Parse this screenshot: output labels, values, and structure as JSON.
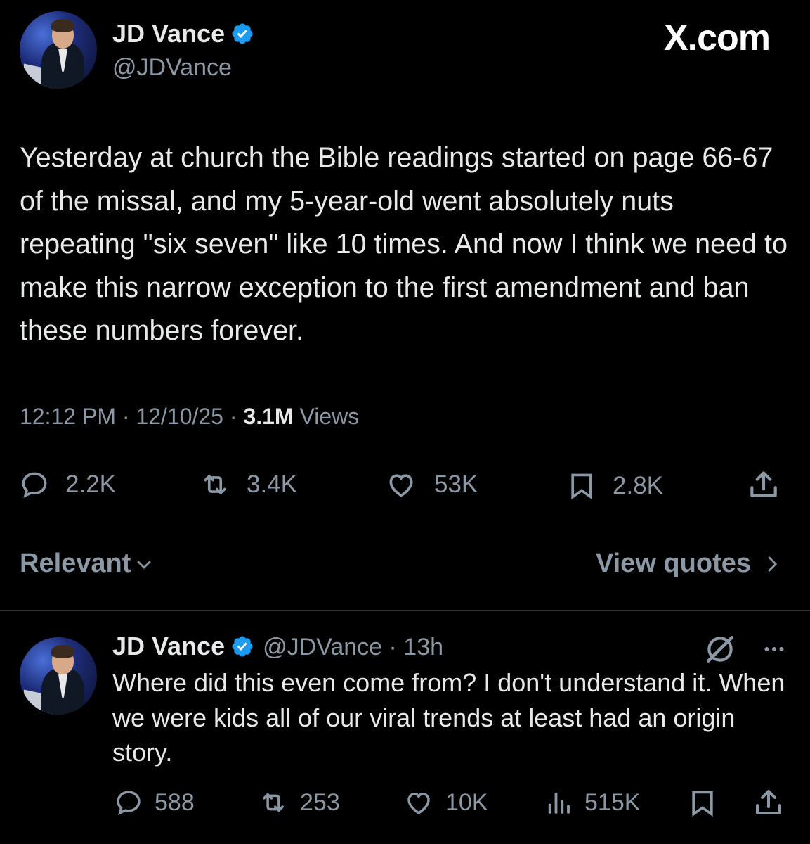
{
  "watermark": "X.com",
  "main_post": {
    "author_name": "JD Vance",
    "handle": "@JDVance",
    "text": "Yesterday at church the Bible readings started on page 66-67 of the missal, and my 5-year-old went absolutely nuts repeating \"six seven\" like 10 times. And now I think we need to make this narrow exception to the first amendment and ban these numbers forever.",
    "time": "12:12 PM",
    "date": "12/10/25",
    "views_count": "3.1M",
    "views_label": "Views",
    "replies": "2.2K",
    "reposts": "3.4K",
    "likes": "53K",
    "bookmarks": "2.8K"
  },
  "sort_label": "Relevant",
  "view_quotes_label": "View quotes",
  "reply_post": {
    "author_name": "JD Vance",
    "handle": "@JDVance",
    "time_ago": "13h",
    "text": "Where did this even come from? I don't understand it. When we were kids all of our viral trends at least had an origin story.",
    "replies": "588",
    "reposts": "253",
    "likes": "10K",
    "views": "515K"
  },
  "icons": {
    "verified": "verified-badge-icon",
    "reply": "reply-icon",
    "repost": "repost-icon",
    "like": "heart-icon",
    "bookmark": "bookmark-icon",
    "share": "share-icon",
    "views": "views-chart-icon",
    "grok": "grok-icon",
    "more": "more-icon"
  },
  "colors": {
    "background": "#000000",
    "text": "#e7e9ea",
    "secondary": "#8b98a5",
    "verified": "#1d9bf0"
  }
}
